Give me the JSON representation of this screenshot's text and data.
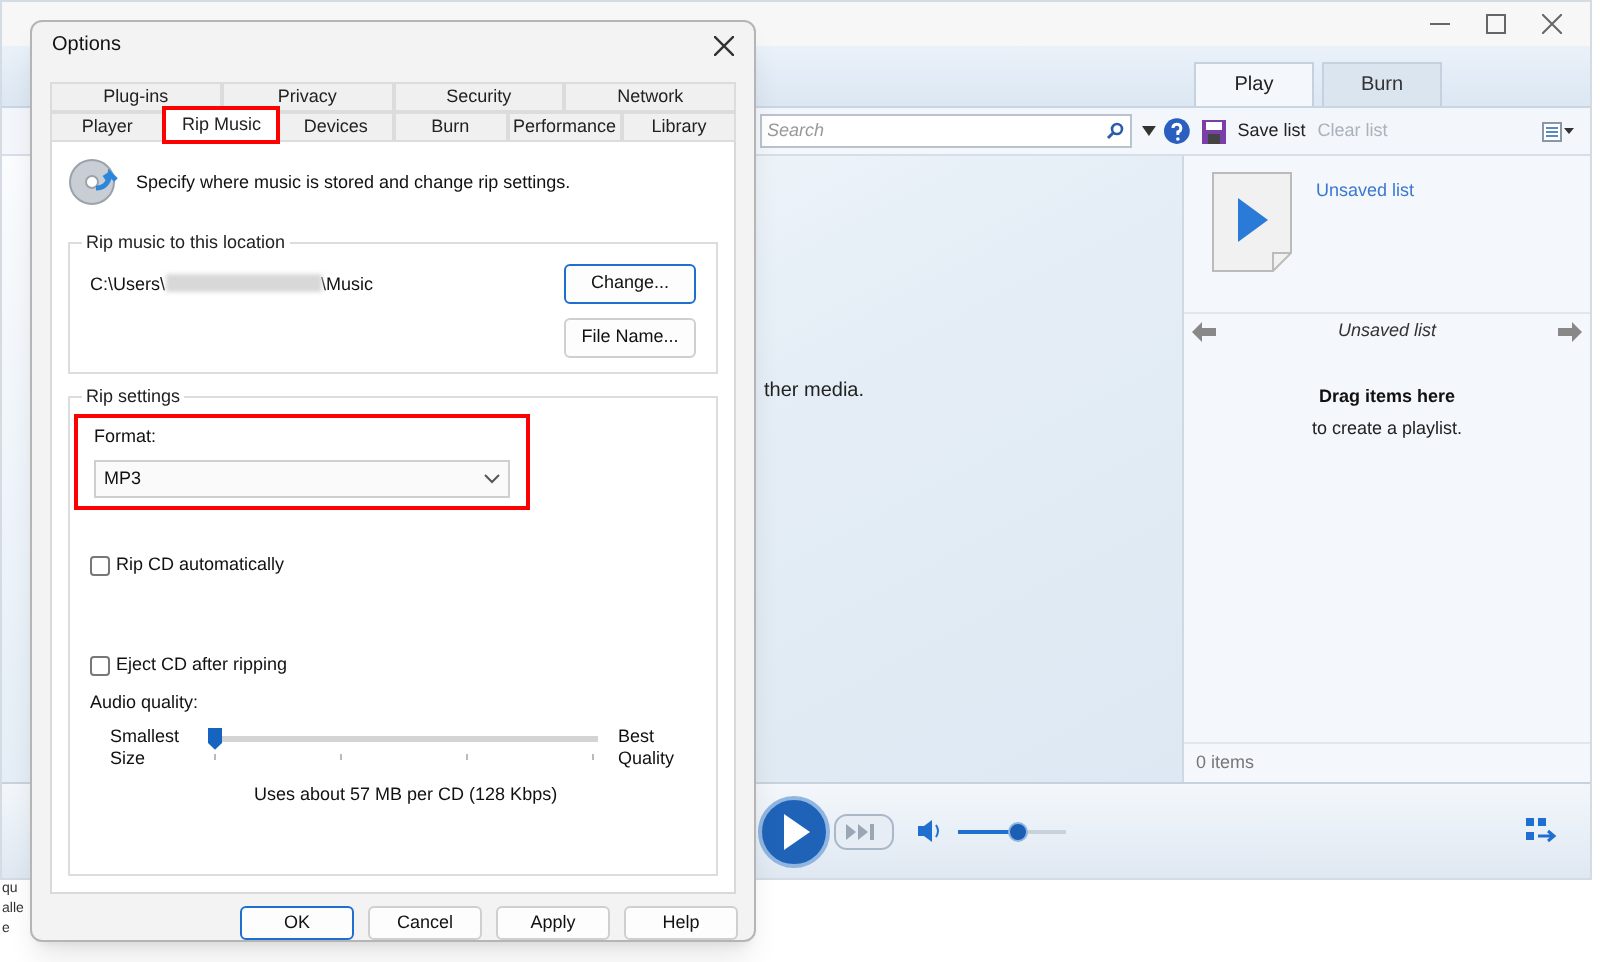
{
  "player": {
    "tabs": [
      {
        "label": "Play",
        "selected": true
      },
      {
        "label": "Burn",
        "selected": false
      }
    ],
    "search": {
      "placeholder": "Search"
    },
    "toolbar": [
      {
        "label": "Save list",
        "disabled": false
      },
      {
        "label": "Clear list",
        "disabled": true
      }
    ],
    "content_text": "ther media.",
    "playlist": {
      "name_link": "Unsaved list",
      "title": "Unsaved list",
      "hint_bold": "Drag items here",
      "hint": "to create a playlist.",
      "count": "0 items"
    },
    "volume": {
      "level": 0.55
    },
    "fragments": [
      "qu",
      "alle",
      "e"
    ]
  },
  "dialog": {
    "title": "Options",
    "tab_rows": [
      [
        {
          "label": "Plug-ins",
          "selected": false,
          "annotated": false
        },
        {
          "label": "Privacy",
          "selected": false,
          "annotated": false
        },
        {
          "label": "Security",
          "selected": false,
          "annotated": false
        },
        {
          "label": "Network",
          "selected": false,
          "annotated": false
        }
      ],
      [
        {
          "label": "Player",
          "selected": false,
          "annotated": false
        },
        {
          "label": "Rip Music",
          "selected": true,
          "annotated": true
        },
        {
          "label": "Devices",
          "selected": false,
          "annotated": false
        },
        {
          "label": "Burn",
          "selected": false,
          "annotated": false
        },
        {
          "label": "Performance",
          "selected": false,
          "annotated": false
        },
        {
          "label": "Library",
          "selected": false,
          "annotated": false
        }
      ]
    ],
    "description": "Specify where music is stored and change rip settings.",
    "location": {
      "group": "Rip music to this location",
      "path_start": "C:\\Users\\",
      "path_end": "\\Music",
      "buttons": [
        "Change...",
        "File Name..."
      ]
    },
    "rip_settings": {
      "group": "Rip settings",
      "format": {
        "label": "Format:",
        "value": "MP3",
        "annotated": true
      },
      "checkboxes": [
        {
          "label": "Rip CD automatically",
          "checked": false
        },
        {
          "label": "Eject CD after ripping",
          "checked": false
        }
      ],
      "quality": {
        "label": "Audio quality:",
        "min_label": "Smallest Size",
        "max_label": "Best Quality",
        "level": 0,
        "reading": "Uses about 57 MB per CD (128 Kbps)"
      }
    },
    "buttons": [
      {
        "label": "OK",
        "default": true
      },
      {
        "label": "Cancel",
        "default": false
      },
      {
        "label": "Apply",
        "default": false
      },
      {
        "label": "Help",
        "default": false
      }
    ]
  }
}
